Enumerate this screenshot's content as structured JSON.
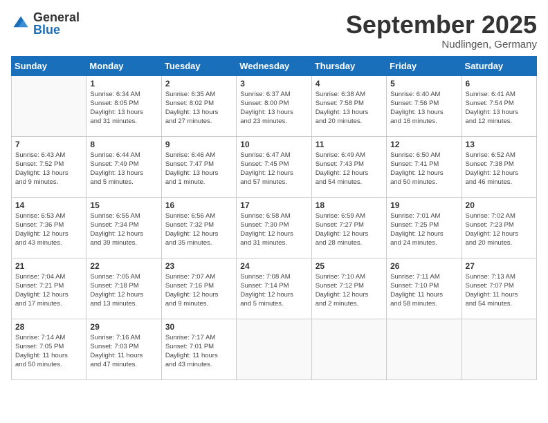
{
  "header": {
    "logo_general": "General",
    "logo_blue": "Blue",
    "month_title": "September 2025",
    "location": "Nudlingen, Germany"
  },
  "weekdays": [
    "Sunday",
    "Monday",
    "Tuesday",
    "Wednesday",
    "Thursday",
    "Friday",
    "Saturday"
  ],
  "weeks": [
    [
      {
        "day": "",
        "info": ""
      },
      {
        "day": "1",
        "info": "Sunrise: 6:34 AM\nSunset: 8:05 PM\nDaylight: 13 hours\nand 31 minutes."
      },
      {
        "day": "2",
        "info": "Sunrise: 6:35 AM\nSunset: 8:02 PM\nDaylight: 13 hours\nand 27 minutes."
      },
      {
        "day": "3",
        "info": "Sunrise: 6:37 AM\nSunset: 8:00 PM\nDaylight: 13 hours\nand 23 minutes."
      },
      {
        "day": "4",
        "info": "Sunrise: 6:38 AM\nSunset: 7:58 PM\nDaylight: 13 hours\nand 20 minutes."
      },
      {
        "day": "5",
        "info": "Sunrise: 6:40 AM\nSunset: 7:56 PM\nDaylight: 13 hours\nand 16 minutes."
      },
      {
        "day": "6",
        "info": "Sunrise: 6:41 AM\nSunset: 7:54 PM\nDaylight: 13 hours\nand 12 minutes."
      }
    ],
    [
      {
        "day": "7",
        "info": "Sunrise: 6:43 AM\nSunset: 7:52 PM\nDaylight: 13 hours\nand 9 minutes."
      },
      {
        "day": "8",
        "info": "Sunrise: 6:44 AM\nSunset: 7:49 PM\nDaylight: 13 hours\nand 5 minutes."
      },
      {
        "day": "9",
        "info": "Sunrise: 6:46 AM\nSunset: 7:47 PM\nDaylight: 13 hours\nand 1 minute."
      },
      {
        "day": "10",
        "info": "Sunrise: 6:47 AM\nSunset: 7:45 PM\nDaylight: 12 hours\nand 57 minutes."
      },
      {
        "day": "11",
        "info": "Sunrise: 6:49 AM\nSunset: 7:43 PM\nDaylight: 12 hours\nand 54 minutes."
      },
      {
        "day": "12",
        "info": "Sunrise: 6:50 AM\nSunset: 7:41 PM\nDaylight: 12 hours\nand 50 minutes."
      },
      {
        "day": "13",
        "info": "Sunrise: 6:52 AM\nSunset: 7:38 PM\nDaylight: 12 hours\nand 46 minutes."
      }
    ],
    [
      {
        "day": "14",
        "info": "Sunrise: 6:53 AM\nSunset: 7:36 PM\nDaylight: 12 hours\nand 43 minutes."
      },
      {
        "day": "15",
        "info": "Sunrise: 6:55 AM\nSunset: 7:34 PM\nDaylight: 12 hours\nand 39 minutes."
      },
      {
        "day": "16",
        "info": "Sunrise: 6:56 AM\nSunset: 7:32 PM\nDaylight: 12 hours\nand 35 minutes."
      },
      {
        "day": "17",
        "info": "Sunrise: 6:58 AM\nSunset: 7:30 PM\nDaylight: 12 hours\nand 31 minutes."
      },
      {
        "day": "18",
        "info": "Sunrise: 6:59 AM\nSunset: 7:27 PM\nDaylight: 12 hours\nand 28 minutes."
      },
      {
        "day": "19",
        "info": "Sunrise: 7:01 AM\nSunset: 7:25 PM\nDaylight: 12 hours\nand 24 minutes."
      },
      {
        "day": "20",
        "info": "Sunrise: 7:02 AM\nSunset: 7:23 PM\nDaylight: 12 hours\nand 20 minutes."
      }
    ],
    [
      {
        "day": "21",
        "info": "Sunrise: 7:04 AM\nSunset: 7:21 PM\nDaylight: 12 hours\nand 17 minutes."
      },
      {
        "day": "22",
        "info": "Sunrise: 7:05 AM\nSunset: 7:18 PM\nDaylight: 12 hours\nand 13 minutes."
      },
      {
        "day": "23",
        "info": "Sunrise: 7:07 AM\nSunset: 7:16 PM\nDaylight: 12 hours\nand 9 minutes."
      },
      {
        "day": "24",
        "info": "Sunrise: 7:08 AM\nSunset: 7:14 PM\nDaylight: 12 hours\nand 5 minutes."
      },
      {
        "day": "25",
        "info": "Sunrise: 7:10 AM\nSunset: 7:12 PM\nDaylight: 12 hours\nand 2 minutes."
      },
      {
        "day": "26",
        "info": "Sunrise: 7:11 AM\nSunset: 7:10 PM\nDaylight: 11 hours\nand 58 minutes."
      },
      {
        "day": "27",
        "info": "Sunrise: 7:13 AM\nSunset: 7:07 PM\nDaylight: 11 hours\nand 54 minutes."
      }
    ],
    [
      {
        "day": "28",
        "info": "Sunrise: 7:14 AM\nSunset: 7:05 PM\nDaylight: 11 hours\nand 50 minutes."
      },
      {
        "day": "29",
        "info": "Sunrise: 7:16 AM\nSunset: 7:03 PM\nDaylight: 11 hours\nand 47 minutes."
      },
      {
        "day": "30",
        "info": "Sunrise: 7:17 AM\nSunset: 7:01 PM\nDaylight: 11 hours\nand 43 minutes."
      },
      {
        "day": "",
        "info": ""
      },
      {
        "day": "",
        "info": ""
      },
      {
        "day": "",
        "info": ""
      },
      {
        "day": "",
        "info": ""
      }
    ]
  ]
}
